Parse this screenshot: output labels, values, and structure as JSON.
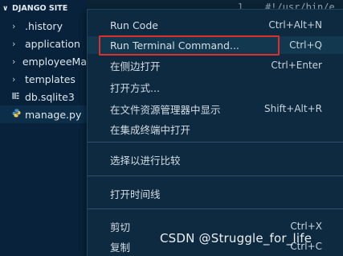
{
  "explorer": {
    "header": "DJANGO SITE",
    "items": [
      {
        "label": ".history",
        "kind": "folder"
      },
      {
        "label": "application",
        "kind": "folder"
      },
      {
        "label": "employeeMa",
        "kind": "folder"
      },
      {
        "label": "templates",
        "kind": "folder"
      },
      {
        "label": "db.sqlite3",
        "kind": "file"
      },
      {
        "label": "manage.py",
        "kind": "python"
      }
    ]
  },
  "editor": {
    "line_number": "1",
    "code": "#!/usr/bin/e"
  },
  "context_menu": {
    "items": [
      {
        "label": "Run Code",
        "shortcut": "Ctrl+Alt+N"
      },
      {
        "label": "Run Terminal Command...",
        "shortcut": "Ctrl+Q"
      },
      {
        "label": "在侧边打开",
        "shortcut": "Ctrl+Enter"
      },
      {
        "label": "打开方式...",
        "shortcut": ""
      },
      {
        "label": "在文件资源管理器中显示",
        "shortcut": "Shift+Alt+R"
      },
      {
        "label": "在集成终端中打开",
        "shortcut": ""
      },
      {
        "label": "选择以进行比较",
        "shortcut": ""
      },
      {
        "label": "打开时间线",
        "shortcut": ""
      },
      {
        "label": "剪切",
        "shortcut": "Ctrl+X"
      },
      {
        "label": "复制",
        "shortcut": "Ctrl+C"
      }
    ]
  },
  "watermark": "CSDN @Struggle_for_life",
  "colors": {
    "highlight_border": "#d9302c",
    "menu_background": "#0d2a40",
    "sidebar_background": "#07223a"
  }
}
